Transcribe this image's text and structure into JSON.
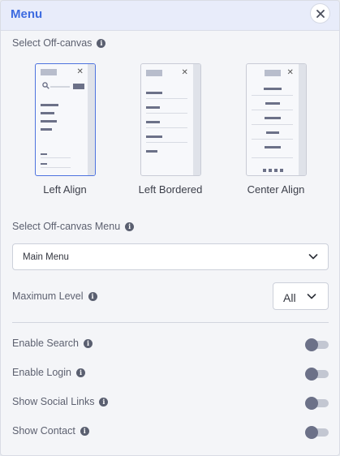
{
  "header": {
    "title": "Menu",
    "close_icon": "close-icon"
  },
  "offcanvas": {
    "label": "Select Off-canvas",
    "options": [
      {
        "id": "left-align",
        "label": "Left Align",
        "selected": true
      },
      {
        "id": "left-bordered",
        "label": "Left Bordered",
        "selected": false
      },
      {
        "id": "center-align",
        "label": "Center Align",
        "selected": false
      }
    ]
  },
  "offcanvas_menu": {
    "label": "Select Off-canvas Menu",
    "value": "Main Menu"
  },
  "max_level": {
    "label": "Maximum Level",
    "value": "All"
  },
  "toggles": [
    {
      "id": "enable-search",
      "label": "Enable Search",
      "on": false
    },
    {
      "id": "enable-login",
      "label": "Enable Login",
      "on": false
    },
    {
      "id": "show-social-links",
      "label": "Show Social Links",
      "on": false
    },
    {
      "id": "show-contact",
      "label": "Show Contact",
      "on": false
    }
  ],
  "colors": {
    "accent": "#3d6be0",
    "selected_border": "#4e73df",
    "knob": "#6c7188",
    "track": "#c3c7d2"
  }
}
